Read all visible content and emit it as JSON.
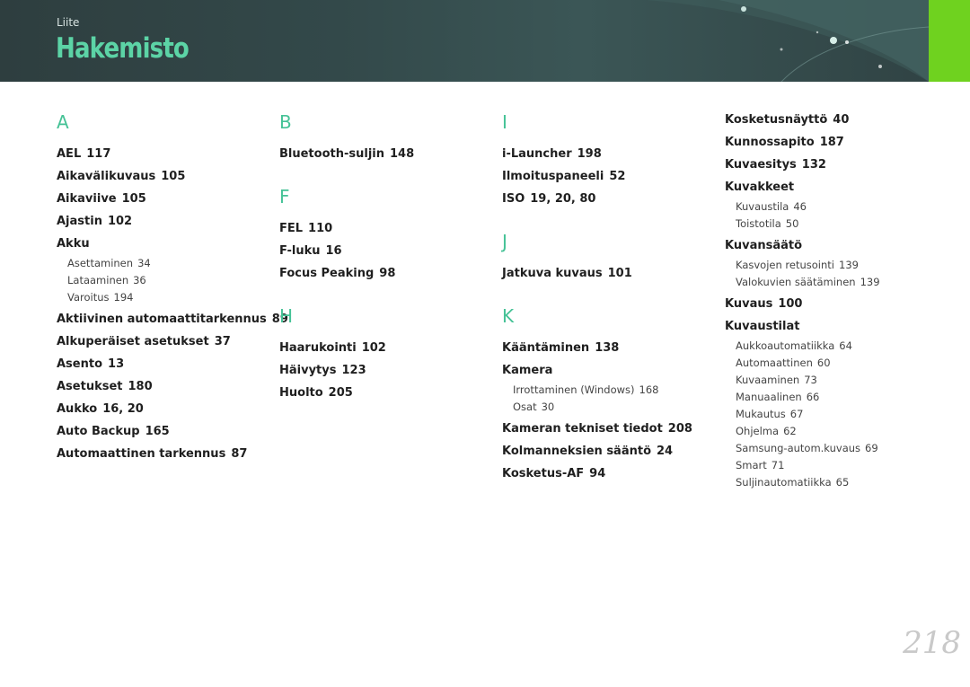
{
  "header": {
    "section": "Liite",
    "title": "Hakemisto"
  },
  "columns": [
    {
      "groups": [
        {
          "letter": "A",
          "entries": [
            {
              "term": "AEL",
              "pages": "117"
            },
            {
              "term": "Aikavälikuvaus",
              "pages": "105"
            },
            {
              "term": "Aikaviive",
              "pages": "105"
            },
            {
              "term": "Ajastin",
              "pages": "102"
            },
            {
              "term": "Akku",
              "pages": "",
              "subs": [
                {
                  "term": "Asettaminen",
                  "pages": "34"
                },
                {
                  "term": "Lataaminen",
                  "pages": "36"
                },
                {
                  "term": "Varoitus",
                  "pages": "194"
                }
              ]
            },
            {
              "term": "Aktiivinen automaattitarkennus",
              "pages": "89"
            },
            {
              "term": "Alkuperäiset asetukset",
              "pages": "37"
            },
            {
              "term": "Asento",
              "pages": "13"
            },
            {
              "term": "Asetukset",
              "pages": "180"
            },
            {
              "term": "Aukko",
              "pages": "16, 20"
            },
            {
              "term": "Auto Backup",
              "pages": "165"
            },
            {
              "term": "Automaattinen tarkennus",
              "pages": "87"
            }
          ]
        }
      ]
    },
    {
      "groups": [
        {
          "letter": "B",
          "entries": [
            {
              "term": "Bluetooth-suljin",
              "pages": "148"
            }
          ]
        },
        {
          "letter": "F",
          "entries": [
            {
              "term": "FEL",
              "pages": "110"
            },
            {
              "term": "F-luku",
              "pages": "16"
            },
            {
              "term": "Focus Peaking",
              "pages": "98"
            }
          ]
        },
        {
          "letter": "H",
          "entries": [
            {
              "term": "Haarukointi",
              "pages": "102"
            },
            {
              "term": "Häivytys",
              "pages": "123"
            },
            {
              "term": "Huolto",
              "pages": "205"
            }
          ]
        }
      ]
    },
    {
      "groups": [
        {
          "letter": "I",
          "entries": [
            {
              "term": "i-Launcher",
              "pages": "198"
            },
            {
              "term": "Ilmoituspaneeli",
              "pages": "52"
            },
            {
              "term": "ISO",
              "pages": "19, 20, 80"
            }
          ]
        },
        {
          "letter": "J",
          "entries": [
            {
              "term": "Jatkuva kuvaus",
              "pages": "101"
            }
          ]
        },
        {
          "letter": "K",
          "entries": [
            {
              "term": "Kääntäminen",
              "pages": "138"
            },
            {
              "term": "Kamera",
              "pages": "",
              "subs": [
                {
                  "term": "Irrottaminen (Windows)",
                  "pages": "168"
                },
                {
                  "term": "Osat",
                  "pages": "30"
                }
              ]
            },
            {
              "term": "Kameran tekniset tiedot",
              "pages": "208"
            },
            {
              "term": "Kolmanneksien sääntö",
              "pages": "24"
            },
            {
              "term": "Kosketus-AF",
              "pages": "94"
            }
          ]
        }
      ]
    },
    {
      "groups": [
        {
          "letter": "",
          "entries": [
            {
              "term": "Kosketusnäyttö",
              "pages": "40"
            },
            {
              "term": "Kunnossapito",
              "pages": "187"
            },
            {
              "term": "Kuvaesitys",
              "pages": "132"
            },
            {
              "term": "Kuvakkeet",
              "pages": "",
              "subs": [
                {
                  "term": "Kuvaustila",
                  "pages": "46"
                },
                {
                  "term": "Toistotila",
                  "pages": "50"
                }
              ]
            },
            {
              "term": "Kuvansäätö",
              "pages": "",
              "subs": [
                {
                  "term": "Kasvojen retusointi",
                  "pages": "139"
                },
                {
                  "term": "Valokuvien säätäminen",
                  "pages": "139"
                }
              ]
            },
            {
              "term": "Kuvaus",
              "pages": "100"
            },
            {
              "term": "Kuvaustilat",
              "pages": "",
              "subs": [
                {
                  "term": "Aukkoautomatiikka",
                  "pages": "64"
                },
                {
                  "term": "Automaattinen",
                  "pages": "60"
                },
                {
                  "term": "Kuvaaminen",
                  "pages": "73"
                },
                {
                  "term": "Manuaalinen",
                  "pages": "66"
                },
                {
                  "term": "Mukautus",
                  "pages": "67"
                },
                {
                  "term": "Ohjelma",
                  "pages": "62"
                },
                {
                  "term": "Samsung-autom.kuvaus",
                  "pages": "69"
                },
                {
                  "term": "Smart",
                  "pages": "71"
                },
                {
                  "term": "Suljinautomatiikka",
                  "pages": "65"
                }
              ]
            }
          ]
        }
      ]
    }
  ],
  "footer": {
    "page_number": "218"
  },
  "colors": {
    "accent": "#45c296",
    "banner": "#33494a",
    "tab": "#6fd21f"
  }
}
